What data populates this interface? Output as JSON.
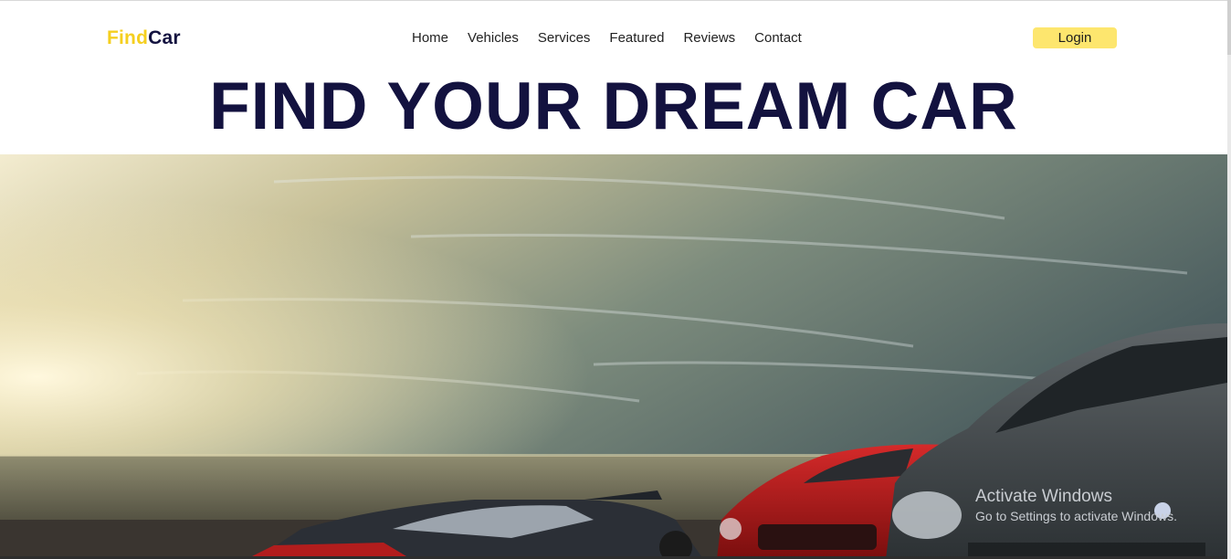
{
  "brand": {
    "part1": "Find",
    "part2": "Car"
  },
  "nav": {
    "items": [
      {
        "label": "Home"
      },
      {
        "label": "Vehicles"
      },
      {
        "label": "Services"
      },
      {
        "label": "Featured"
      },
      {
        "label": "Reviews"
      },
      {
        "label": "Contact"
      }
    ],
    "login_label": "Login"
  },
  "hero": {
    "title": "FIND YOUR DREAM CAR"
  },
  "watermark": {
    "title": "Activate Windows",
    "subtitle": "Go to Settings to activate Windows."
  },
  "colors": {
    "brand_yellow": "#f5cf1f",
    "brand_navy": "#13123f",
    "login_bg": "#fde66e"
  }
}
